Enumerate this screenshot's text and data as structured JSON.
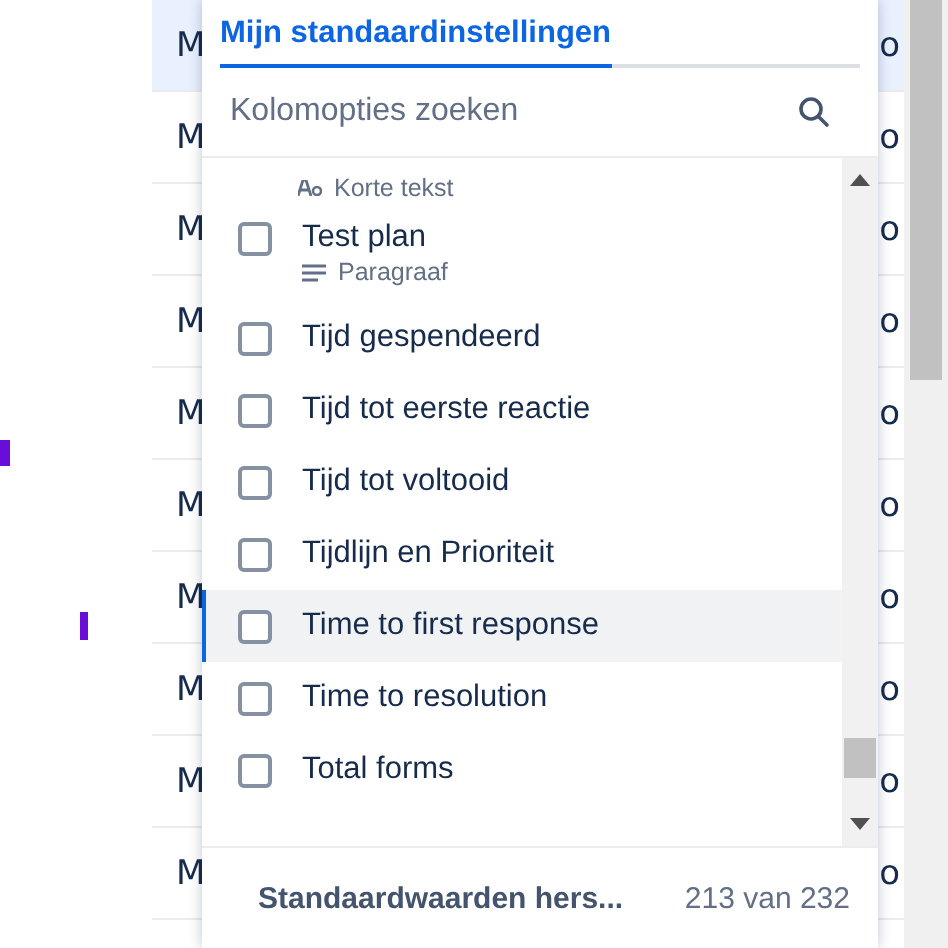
{
  "table": {
    "rows": [
      {
        "column_1": "M",
        "column_2": "o",
        "selected": true
      },
      {
        "column_1": "M",
        "column_2": "o",
        "selected": false
      },
      {
        "column_1": "M",
        "column_2": "o",
        "selected": false
      },
      {
        "column_1": "M",
        "column_2": "o",
        "selected": false
      },
      {
        "column_1": "M",
        "column_2": "o",
        "selected": false
      },
      {
        "column_1": "M",
        "column_2": "o",
        "selected": false
      },
      {
        "column_1": "M",
        "column_2": "o",
        "selected": false
      },
      {
        "column_1": "M",
        "column_2": "o",
        "selected": false
      },
      {
        "column_1": "M",
        "column_2": "o",
        "selected": false
      },
      {
        "column_1": "M",
        "column_2": "o",
        "selected": false
      }
    ]
  },
  "popup": {
    "tabs": [
      {
        "label": "Mijn standaardinstellingen",
        "selected": true
      }
    ],
    "search": {
      "placeholder": "Kolomopties zoeken"
    },
    "options": [
      {
        "kind": "partial",
        "subtitle": {
          "text": "Korte tekst",
          "kind": "short-text"
        }
      },
      {
        "kind": "option",
        "label": "Test plan",
        "subtitle": {
          "text": "Paragraaf",
          "kind": "paragraph"
        },
        "checked": false,
        "hovered": false
      },
      {
        "kind": "option",
        "label": "Tijd gespendeerd",
        "checked": false,
        "hovered": false
      },
      {
        "kind": "option",
        "label": "Tijd tot eerste reactie",
        "checked": false,
        "hovered": false
      },
      {
        "kind": "option",
        "label": "Tijd tot voltooid",
        "checked": false,
        "hovered": false
      },
      {
        "kind": "option",
        "label": "Tijdlijn en Prioriteit",
        "checked": false,
        "hovered": false
      },
      {
        "kind": "option",
        "label": "Time to first response",
        "checked": false,
        "hovered": true
      },
      {
        "kind": "option",
        "label": "Time to resolution",
        "checked": false,
        "hovered": false
      },
      {
        "kind": "option",
        "label": "Total forms",
        "checked": false,
        "hovered": false
      }
    ],
    "footer": {
      "reset_button": "Standaardwaarden hers...",
      "count": "213 van 232"
    }
  }
}
